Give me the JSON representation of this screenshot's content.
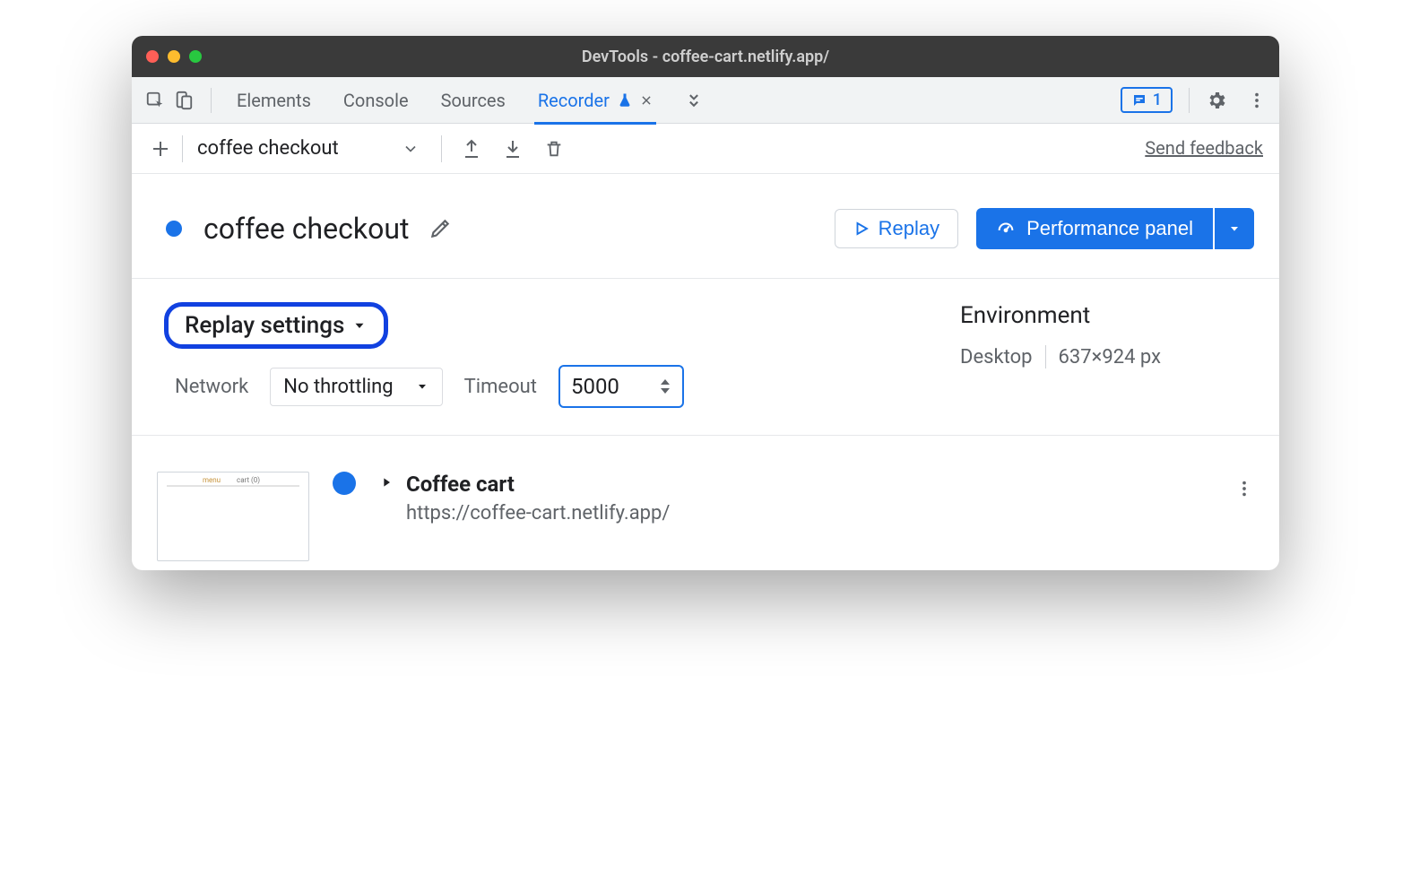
{
  "window": {
    "title": "DevTools - coffee-cart.netlify.app/"
  },
  "tabs": {
    "elements": "Elements",
    "console": "Console",
    "sources": "Sources",
    "recorder": "Recorder",
    "issues_count": "1"
  },
  "subbar": {
    "recording_select": "coffee checkout",
    "feedback": "Send feedback"
  },
  "header": {
    "title": "coffee checkout",
    "replay": "Replay",
    "performance": "Performance panel"
  },
  "settings": {
    "label": "Replay settings",
    "network_label": "Network",
    "network_value": "No throttling",
    "timeout_label": "Timeout",
    "timeout_value": "5000"
  },
  "environment": {
    "title": "Environment",
    "device": "Desktop",
    "dimensions": "637×924 px"
  },
  "step0": {
    "title": "Coffee cart",
    "url": "https://coffee-cart.netlify.app/"
  }
}
